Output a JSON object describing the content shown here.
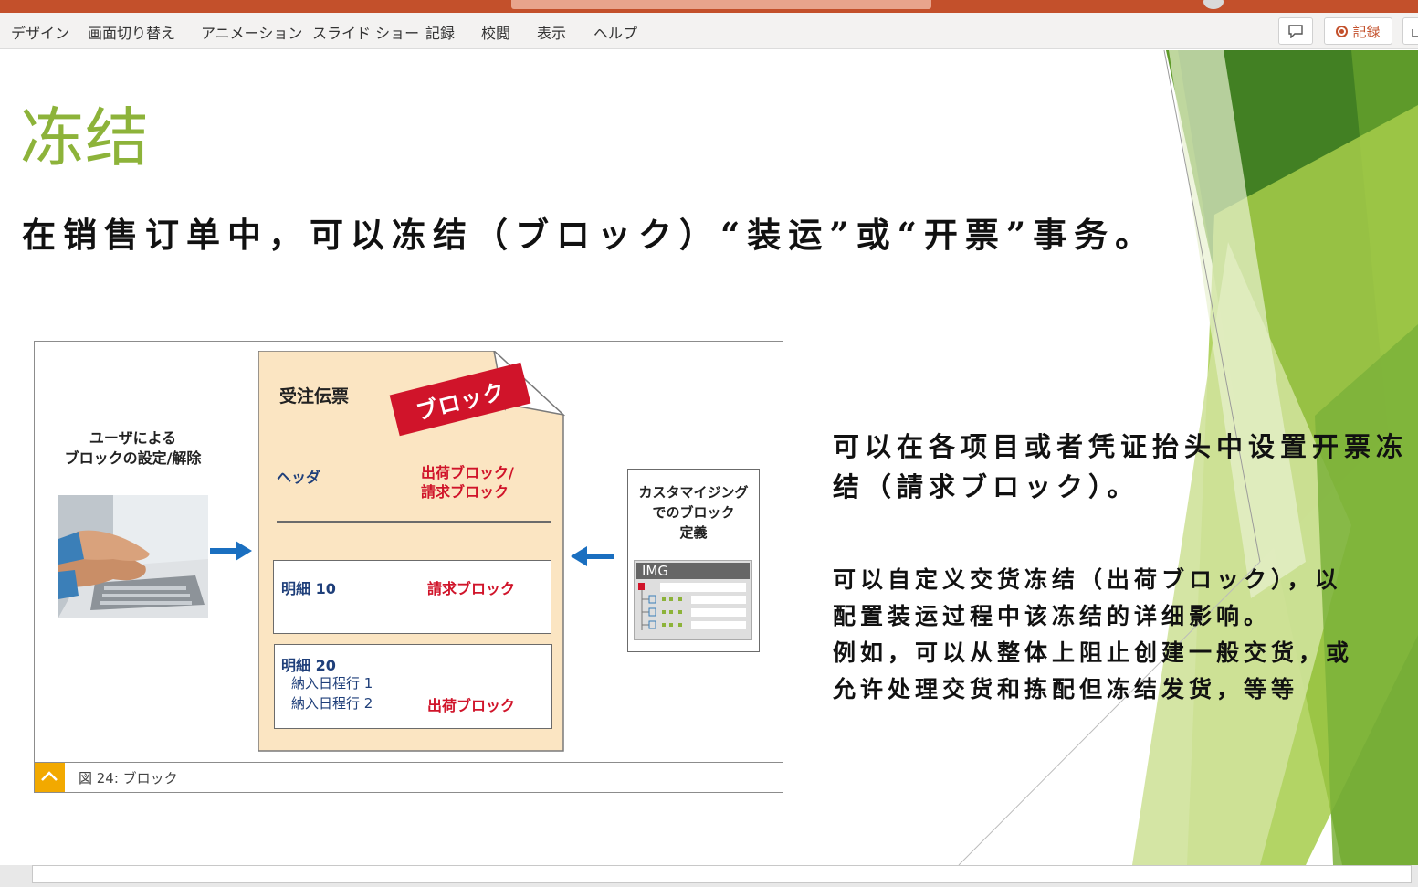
{
  "ribbon": {
    "tabs": [
      {
        "label": "デザイン"
      },
      {
        "label": "画面切り替え"
      },
      {
        "label": "アニメーション"
      },
      {
        "label": "スライド ショー"
      },
      {
        "label": "記録"
      },
      {
        "label": "校閲"
      },
      {
        "label": "表示"
      },
      {
        "label": "ヘルプ"
      }
    ],
    "record_button_label": "記録"
  },
  "slide": {
    "title": "冻结",
    "intro": "在销售订单中，可以冻结（ブロック）“装运”或“开票”事务。",
    "paragraph1": "可以在各项目或者凭证抬头中设置开票冻结（請求ブロック）。",
    "paragraph2_lines": [
      "可以自定义交货冻结（出荷ブロック），以",
      "配置装运过程中该冻结的详细影响。",
      "例如，可以从整体上阻止创建一般交货，或",
      "允许处理交货和拣配但冻结发货，等等"
    ]
  },
  "figure": {
    "user_label": "ユーザによる\nブロックの設定/解除",
    "doc_title": "受注伝票",
    "stamp": "ブロック",
    "header_label": "ヘッダ",
    "header_value": "出荷ブロック/\n請求ブロック",
    "item10_label": "明細 10",
    "item10_value": "請求ブロック",
    "item20_label": "明細 20",
    "item20_sub1": "納入日程行 1",
    "item20_sub2": "納入日程行 2",
    "item20_value": "出荷ブロック",
    "custom_label": "カスタマイジング\nでのブロック\n定義",
    "img_label": "IMG",
    "caption": "図 24: ブロック"
  },
  "colors": {
    "title_green": "#8db33a",
    "accent_orange": "#c3502b",
    "block_red": "#d0142a",
    "doc_fill": "#fbe5c2",
    "arrow_blue": "#1a6fc0"
  }
}
